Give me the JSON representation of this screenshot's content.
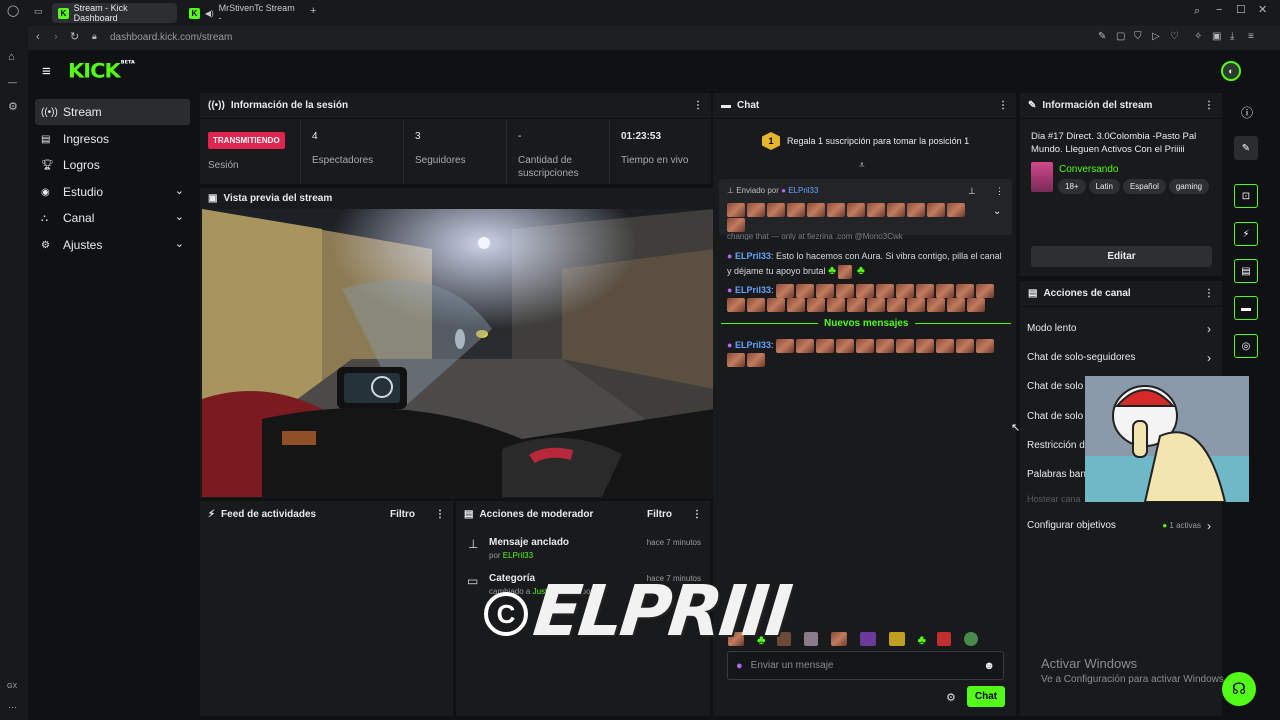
{
  "browser": {
    "tabs": [
      {
        "label": "Stream - Kick Dashboard"
      },
      {
        "label": "MrStivenTc Stream - "
      }
    ],
    "url_host": "dashboard.kick.com",
    "url_path": "/stream"
  },
  "app": {
    "logo": "KICK",
    "logo_badge": "BETA"
  },
  "sidebar": {
    "items": [
      {
        "label": "Stream",
        "icon": "broadcast-icon"
      },
      {
        "label": "Ingresos",
        "icon": "wallet-icon"
      },
      {
        "label": "Logros",
        "icon": "trophy-icon"
      },
      {
        "label": "Estudio",
        "icon": "studio-icon"
      },
      {
        "label": "Canal",
        "icon": "channel-icon"
      },
      {
        "label": "Ajustes",
        "icon": "gear-icon"
      }
    ],
    "rail_label": "GX"
  },
  "session": {
    "title": "Información de la sesión",
    "status": "TRANSMITIENDO",
    "status_label": "Sesión",
    "stats": [
      {
        "value": "4",
        "label": "Espectadores"
      },
      {
        "value": "3",
        "label": "Seguidores"
      },
      {
        "value": "-",
        "label": "Cantidad de suscripciones"
      },
      {
        "value": "01:23:53",
        "label": "Tiempo en vivo"
      }
    ]
  },
  "preview": {
    "title": "Vista previa del stream"
  },
  "activity": {
    "title": "Feed de actividades",
    "filter": "Filtro"
  },
  "modactions": {
    "title": "Acciones de moderador",
    "filter": "Filtro",
    "items": [
      {
        "title": "Mensaje anclado",
        "by_prefix": "por",
        "by_user": "ELPril33",
        "time": "hace 7 minutos"
      },
      {
        "title": "Categoría",
        "detail_prefix": "cambiado a",
        "detail_value": "Just Chatting",
        "by_prefix": "por",
        "time": "hace 7 minutos"
      }
    ]
  },
  "chat": {
    "title": "Chat",
    "gift_rank": "1",
    "gift_text": "Regala 1 suscripción para tomar la posición 1",
    "pinned_by": "Enviado por",
    "pinned_user": "ELPril33",
    "cut_line": "change that — only at fiezrina .com @Mono3Cwk",
    "messages": [
      {
        "user": "ELPril33",
        "text": ": Esto lo hacemos con Aura. Si vibra contigo, pilla el canal y déjame tu apoyo brutal"
      },
      {
        "user": "ELPril33",
        "text": ":"
      }
    ],
    "new_messages": "Nuevos mensajes",
    "last_user": "ELPril33",
    "input_placeholder": "Enviar un mensaje",
    "send_label": "Chat"
  },
  "stream_info": {
    "title": "Información del stream",
    "stream_title": "Dia #17 Direct. 3.0Colombia -Pasto Pal Mundo. Lleguen Activos Con el Priiiii",
    "category": "Conversando",
    "tags": [
      "18+",
      "Latin",
      "Español",
      "gaming"
    ],
    "edit_label": "Editar"
  },
  "channel_actions": {
    "title": "Acciones de canal",
    "items": [
      {
        "label": "Modo lento"
      },
      {
        "label": "Chat de solo-seguidores"
      },
      {
        "label": "Chat de solo"
      },
      {
        "label": "Chat de solo"
      },
      {
        "label": "Restricción d"
      },
      {
        "label": "Palabras ban"
      },
      {
        "label": "Hostear cana"
      },
      {
        "label": "Configurar objetivos",
        "extra": "1 activas"
      }
    ]
  },
  "overlay": {
    "watermark": "ELPRIII",
    "windows_title": "Activar Windows",
    "windows_sub": "Ve a Configuración para activar Windows."
  },
  "colors": {
    "accent": "#53fc18",
    "live": "#e0254f",
    "user": "#66a3ff",
    "panel": "#191a1c"
  }
}
